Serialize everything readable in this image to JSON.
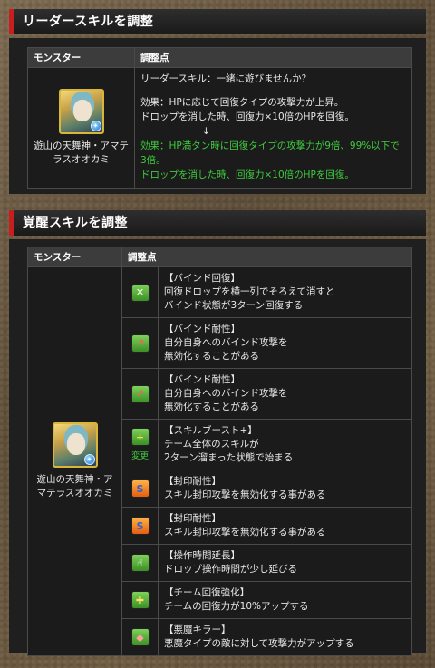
{
  "leader_section": {
    "title": "リーダースキルを調整",
    "col_monster": "モンスター",
    "col_points": "調整点",
    "monster_name_line1": "遊山の天舞神・アマテ",
    "monster_name_line2": "ラスオオカミ",
    "skill_name": "リーダースキル：一緒に遊びませんか？",
    "before_line1": "効果：HPに応じて回復タイプの攻撃力が上昇。",
    "before_line2": "ドロップを消した時、回復力×10倍のHPを回復。",
    "arrow": "↓",
    "after_line1": "効果：HP満タン時に回復タイプの攻撃力が9倍、99%以下で",
    "after_line2": "3倍。",
    "after_line3": "ドロップを消した時、回復力×10倍のHPを回復。"
  },
  "awakening_section": {
    "title": "覚醒スキルを調整",
    "col_monster": "モンスター",
    "col_points": "調整点",
    "monster_name_line1": "遊山の天舞神・ア",
    "monster_name_line2": "マテラスオオカミ",
    "change_label": "変更",
    "rows": [
      {
        "icon": "bind-recovery-icon",
        "name": "【バインド回復】",
        "desc1": "回復ドロップを横一列でそろえて消すと",
        "desc2": "バインド状態が3ターン回復する"
      },
      {
        "icon": "bind-resist-icon",
        "name": "【バインド耐性】",
        "desc1": "自分自身へのバインド攻撃を",
        "desc2": "無効化することがある"
      },
      {
        "icon": "bind-resist-icon",
        "name": "【バインド耐性】",
        "desc1": "自分自身へのバインド攻撃を",
        "desc2": "無効化することがある"
      },
      {
        "icon": "skill-boost-plus-icon",
        "name": "【スキルブースト+】",
        "desc1": "チーム全体のスキルが",
        "desc2": "2ターン溜まった状態で始まる"
      },
      {
        "icon": "seal-resist-icon",
        "name": "【封印耐性】",
        "desc1": "スキル封印攻撃を無効化する事がある",
        "desc2": ""
      },
      {
        "icon": "seal-resist-icon",
        "name": "【封印耐性】",
        "desc1": "スキル封印攻撃を無効化する事がある",
        "desc2": ""
      },
      {
        "icon": "time-extend-icon",
        "name": "【操作時間延長】",
        "desc1": "ドロップ操作時間が少し延びる",
        "desc2": ""
      },
      {
        "icon": "team-recovery-icon",
        "name": "【チーム回復強化】",
        "desc1": "チームの回復力が10%アップする",
        "desc2": ""
      },
      {
        "icon": "devil-killer-icon",
        "name": "【悪魔キラー】",
        "desc1": "悪魔タイプの敵に対して攻撃力がアップする",
        "desc2": ""
      }
    ]
  }
}
